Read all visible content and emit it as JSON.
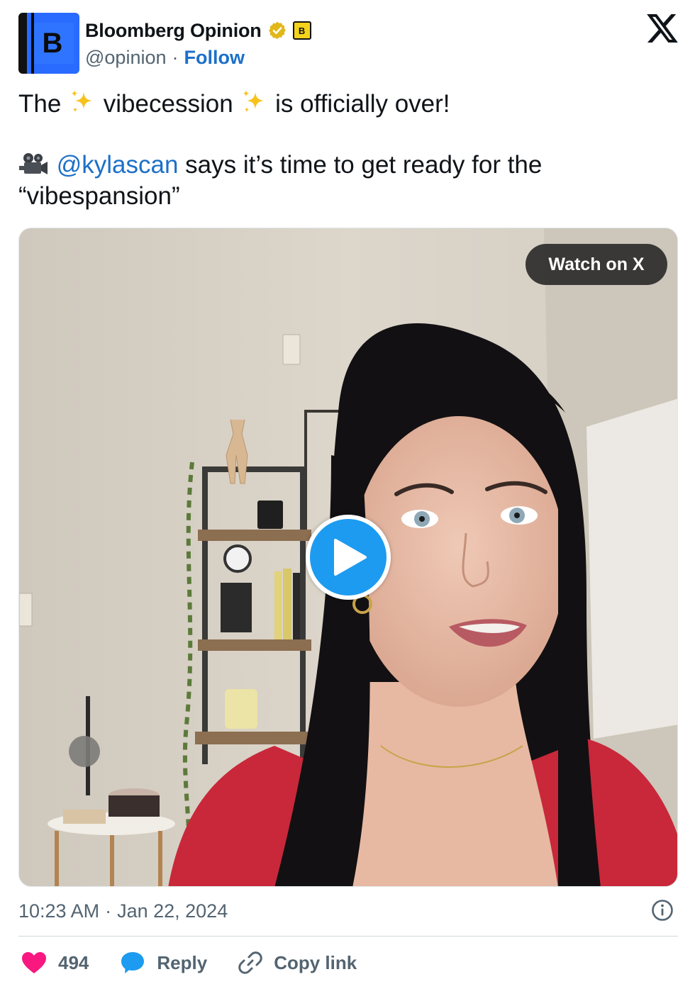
{
  "header": {
    "avatar_letter": "B",
    "display_name": "Bloomberg Opinion",
    "affiliate_badge_letter": "B",
    "handle": "@opinion",
    "separator": "·",
    "follow_label": "Follow"
  },
  "tweet": {
    "line1": {
      "before": "The",
      "middle": "vibecession",
      "after": "is officially over!"
    },
    "line2": {
      "mention": "@kylascan",
      "text": " says it’s time to get ready for the"
    },
    "line3": "“vibespansion”"
  },
  "media": {
    "watch_label": "Watch on X"
  },
  "footer": {
    "time": "10:23 AM",
    "separator": "·",
    "date": "Jan 22, 2024",
    "likes": "494",
    "reply_label": "Reply",
    "copy_label": "Copy link"
  },
  "colors": {
    "link": "#1d70c8",
    "play": "#1d9bf0",
    "like": "#f91880",
    "reply": "#1d9bf0"
  },
  "icons": [
    "verified-badge-icon",
    "x-logo-icon",
    "sparkles-icon",
    "movie-camera-icon",
    "play-icon",
    "info-icon",
    "heart-icon",
    "speech-bubble-icon",
    "link-icon"
  ]
}
